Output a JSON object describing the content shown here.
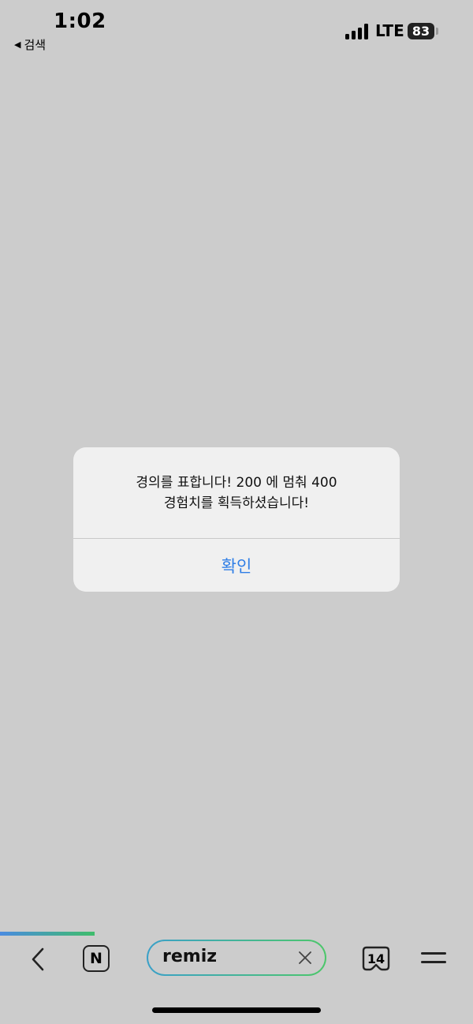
{
  "status_bar": {
    "time": "1:02",
    "back_label": "검색",
    "network": "LTE",
    "battery": "83"
  },
  "alert": {
    "message_line1": "경의를 표합니다! 200 에 멈춰 400",
    "message_line2": "경험치를 획득하셨습니다!",
    "confirm_label": "확인",
    "confirm_color": "#2f7ee6"
  },
  "page_load": {
    "progress_fraction": 0.2
  },
  "toolbar": {
    "back_icon": "chevron-left-icon",
    "naver_label": "N",
    "search_text": "remiz",
    "clear_icon": "close-icon",
    "tab_count": "14",
    "menu_icon": "hamburger-icon"
  }
}
